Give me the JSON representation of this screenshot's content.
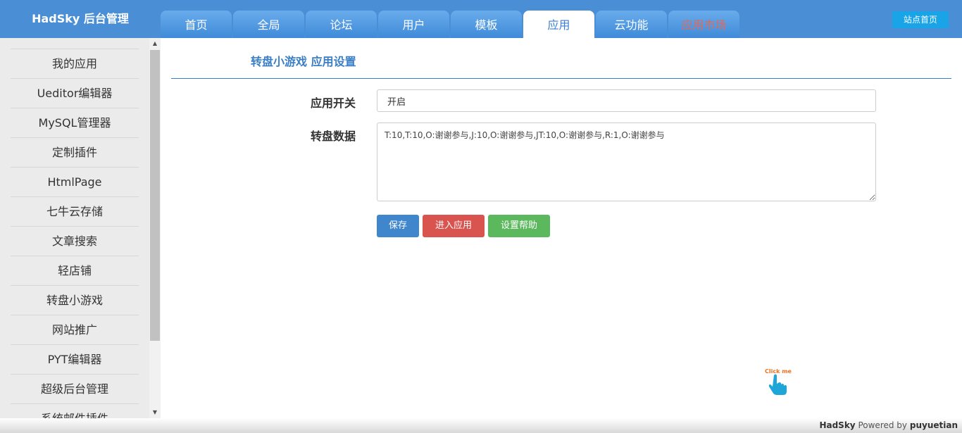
{
  "header": {
    "brand": "HadSky 后台管理",
    "site_home": "站点首页",
    "tabs": [
      {
        "label": "首页"
      },
      {
        "label": "全局"
      },
      {
        "label": "论坛"
      },
      {
        "label": "用户"
      },
      {
        "label": "模板"
      },
      {
        "label": "应用",
        "active": true
      },
      {
        "label": "云功能"
      },
      {
        "label": "应用市场"
      }
    ]
  },
  "sidebar": {
    "items": [
      {
        "label": "我的应用"
      },
      {
        "label": "Ueditor编辑器"
      },
      {
        "label": "MySQL管理器"
      },
      {
        "label": "定制插件"
      },
      {
        "label": "HtmlPage"
      },
      {
        "label": "七牛云存储"
      },
      {
        "label": "文章搜索"
      },
      {
        "label": "轻店铺"
      },
      {
        "label": "转盘小游戏"
      },
      {
        "label": "网站推广"
      },
      {
        "label": "PYT编辑器"
      },
      {
        "label": "超级后台管理"
      },
      {
        "label": "系统邮件插件"
      }
    ]
  },
  "main": {
    "title": "转盘小游戏 应用设置",
    "switch_label": "应用开关",
    "switch_value": "开启",
    "data_label": "转盘数据",
    "data_value": "T:10,T:10,O:谢谢参与,J:10,O:谢谢参与,JT:10,O:谢谢参与,R:1,O:谢谢参与",
    "buttons": {
      "save": "保存",
      "enter": "进入应用",
      "help": "设置帮助"
    }
  },
  "widget": {
    "clickme_text": "Click me",
    "icon": "pointing-hand-icon"
  },
  "footer": {
    "brand": "HadSky",
    "powered": "Powered by",
    "author": "puyuetian"
  },
  "colors": {
    "header_bg": "#4a8fd6",
    "accent": "#3a7fc6",
    "danger": "#d9534f",
    "success": "#5cb85c"
  }
}
